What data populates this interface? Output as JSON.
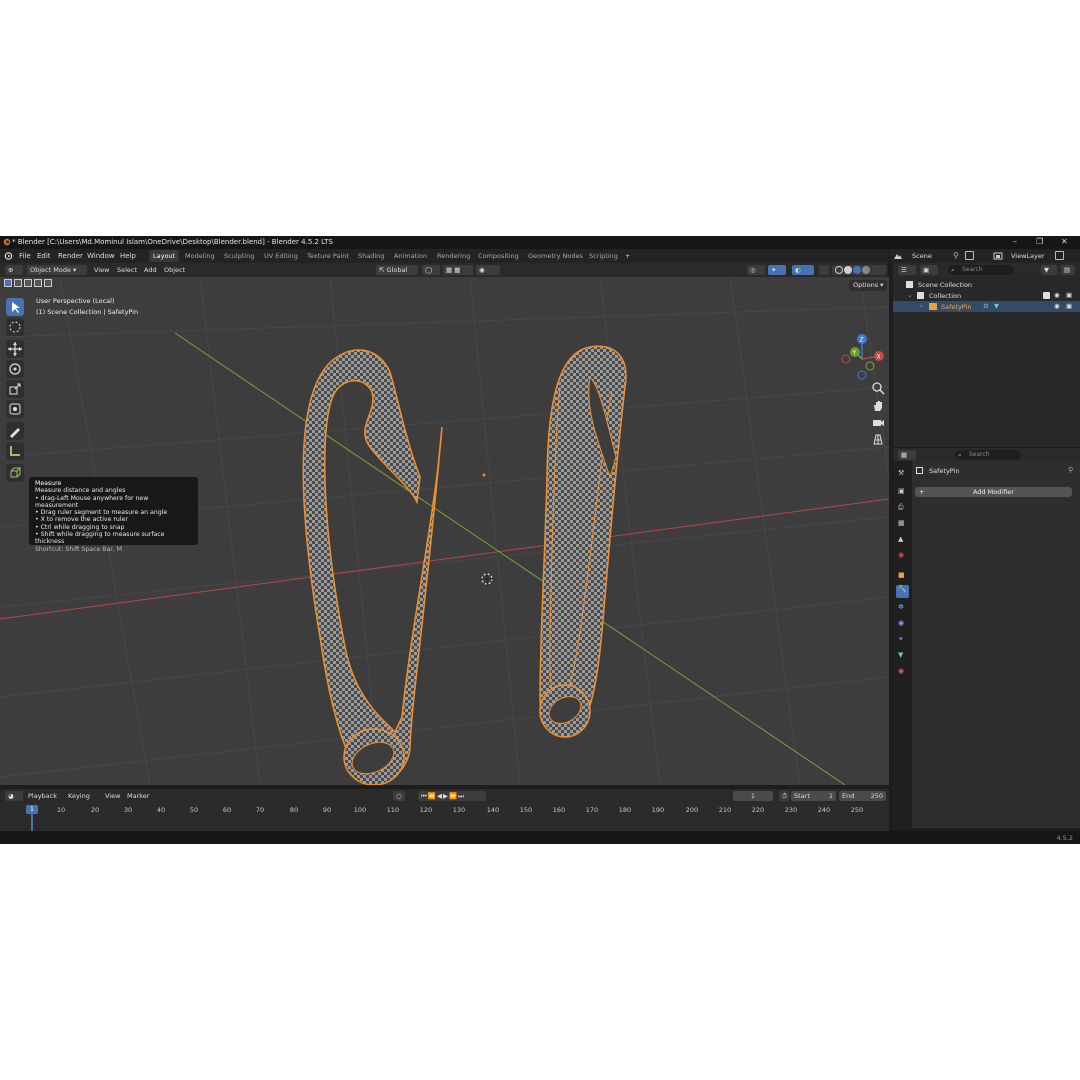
{
  "window": {
    "title": "* Blender [C:\\Users\\Md.Mominul Islam\\OneDrive\\Desktop\\Blender.blend] - Blender 4.5.2 LTS"
  },
  "menu": [
    "File",
    "Edit",
    "Render",
    "Window",
    "Help"
  ],
  "workspaces": [
    "Layout",
    "Modeling",
    "Sculpting",
    "UV Editing",
    "Texture Paint",
    "Shading",
    "Animation",
    "Rendering",
    "Compositing",
    "Geometry Nodes",
    "Scripting"
  ],
  "active_workspace": "Layout",
  "viewport_header": {
    "mode": "Object Mode",
    "menus": [
      "View",
      "Select",
      "Add",
      "Object"
    ],
    "orientation": "Global",
    "options": "Options"
  },
  "viewport": {
    "perspective": "User Perspective (Local)",
    "collection_path": "(1) Scene Collection | SafetyPin",
    "gizmo_axes": [
      "Z",
      "Y",
      "X"
    ]
  },
  "tooltip": {
    "title": "Measure",
    "description": "Measure distance and angles",
    "lines": [
      "• drag-Left Mouse anywhere for new measurement",
      "• Drag ruler segment to measure an angle",
      "• X to remove the active ruler",
      "• Ctrl while dragging to snap",
      "• Shift while dragging to measure surface thickness"
    ],
    "shortcut": "Shortcut: Shift Space Bar, M"
  },
  "timeline": {
    "menus": [
      "Playback",
      "Keying",
      "View",
      "Marker"
    ],
    "current_frame": "1",
    "start_label": "Start",
    "start": "1",
    "end_label": "End",
    "end": "250",
    "ticks": [
      "10",
      "20",
      "30",
      "40",
      "50",
      "60",
      "70",
      "80",
      "90",
      "100",
      "110",
      "120",
      "130",
      "140",
      "150",
      "160",
      "170",
      "180",
      "190",
      "200",
      "210",
      "220",
      "230",
      "240",
      "250"
    ]
  },
  "scene": {
    "name": "Scene",
    "view_layer": "ViewLayer"
  },
  "outliner": {
    "search_placeholder": "Search",
    "scene_collection": "Scene Collection",
    "collection": "Collection",
    "object": "SafetyPin"
  },
  "properties": {
    "search_placeholder": "Search",
    "object": "SafetyPin",
    "add_modifier": "Add Modifier"
  },
  "status": {
    "version": "4.5.2"
  },
  "colors": {
    "accent": "#4772b3",
    "selection_outline": "#f0902a",
    "x_axis": "#b24848",
    "y_axis": "#76a53a",
    "z_axis": "#3d7ad6"
  }
}
